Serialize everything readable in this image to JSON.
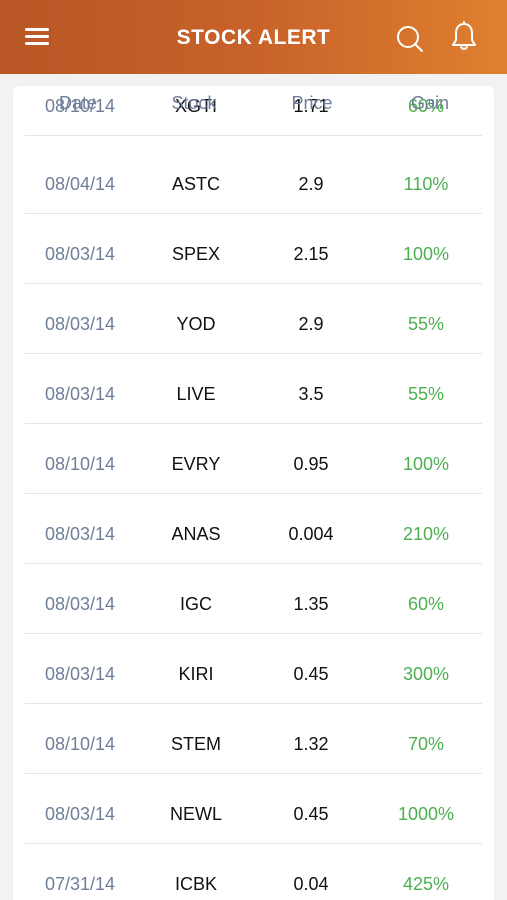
{
  "header": {
    "title": "STOCK ALERT",
    "menu_icon": "hamburger-menu-icon",
    "search_icon": "search-icon",
    "bell_icon": "bell-icon",
    "gradient_start": "#b95626",
    "gradient_end": "#e0802f"
  },
  "table": {
    "columns": [
      "Date",
      "Stock",
      "Price",
      "Gain"
    ],
    "date_color": "#6f7e98",
    "gain_color": "#4caf50",
    "rows": [
      {
        "date": "08/10/14",
        "stock": "XGTI",
        "price": "1.71",
        "gain": "60%"
      },
      {
        "date": "08/04/14",
        "stock": "ASTC",
        "price": "2.9",
        "gain": "110%"
      },
      {
        "date": "08/03/14",
        "stock": "SPEX",
        "price": "2.15",
        "gain": "100%"
      },
      {
        "date": "08/03/14",
        "stock": "YOD",
        "price": "2.9",
        "gain": "55%"
      },
      {
        "date": "08/03/14",
        "stock": "LIVE",
        "price": "3.5",
        "gain": "55%"
      },
      {
        "date": "08/10/14",
        "stock": "EVRY",
        "price": "0.95",
        "gain": "100%"
      },
      {
        "date": "08/03/14",
        "stock": "ANAS",
        "price": "0.004",
        "gain": "210%"
      },
      {
        "date": "08/03/14",
        "stock": "IGC",
        "price": "1.35",
        "gain": "60%"
      },
      {
        "date": "08/03/14",
        "stock": "KIRI",
        "price": "0.45",
        "gain": "300%"
      },
      {
        "date": "08/10/14",
        "stock": "STEM",
        "price": "1.32",
        "gain": "70%"
      },
      {
        "date": "08/03/14",
        "stock": "NEWL",
        "price": "0.45",
        "gain": "1000%"
      },
      {
        "date": "07/31/14",
        "stock": "ICBK",
        "price": "0.04",
        "gain": "425%"
      }
    ]
  }
}
